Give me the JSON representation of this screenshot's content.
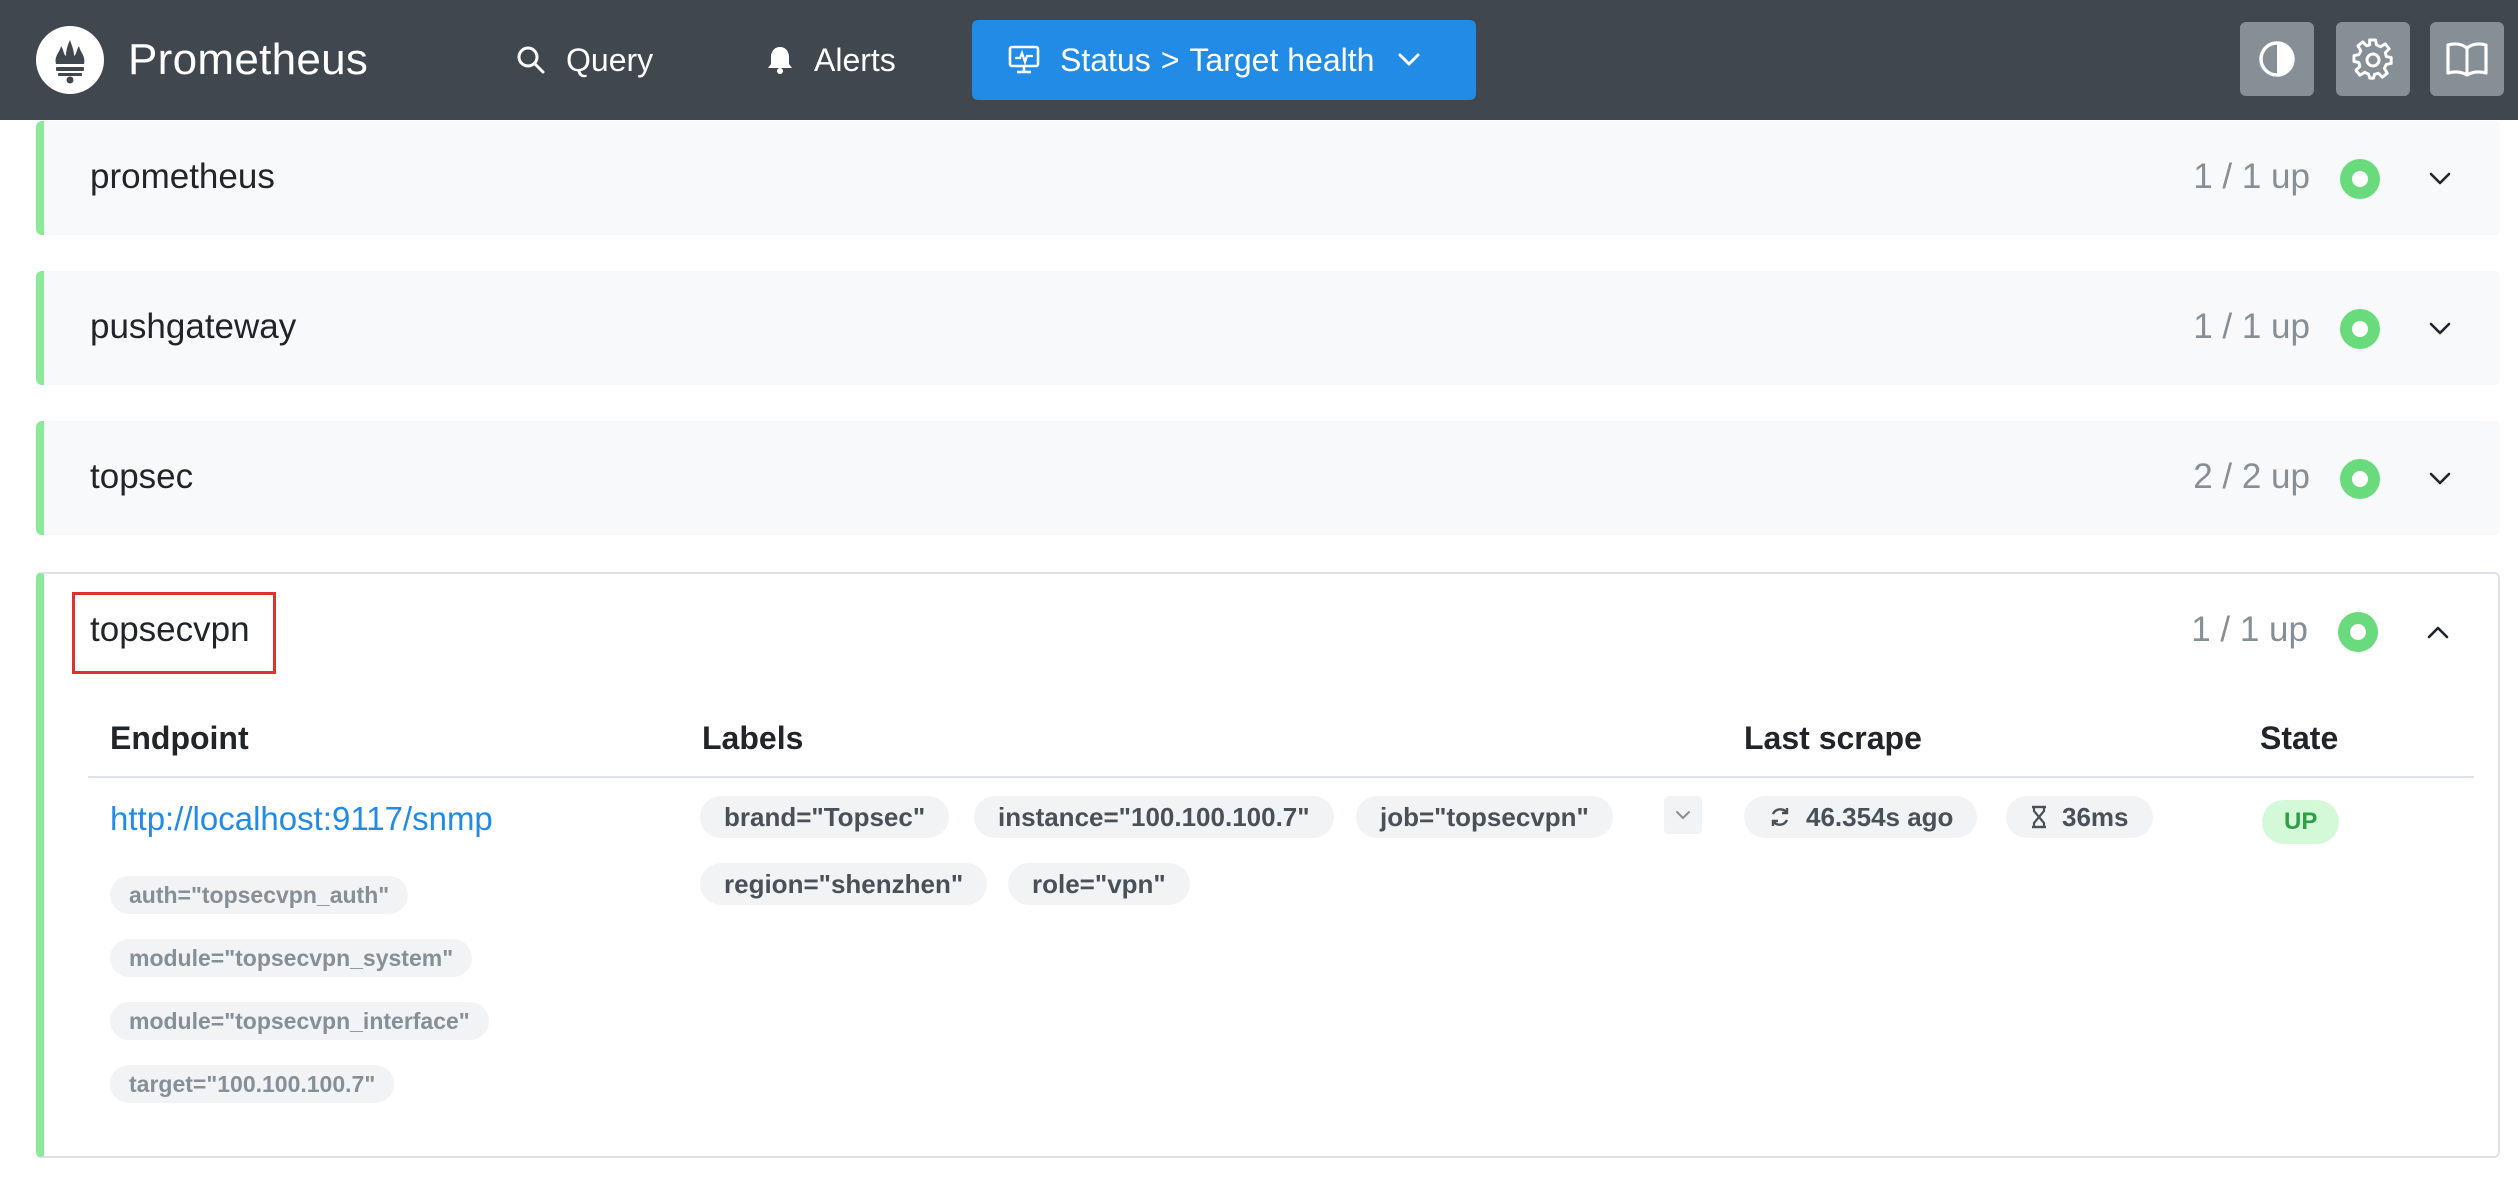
{
  "header": {
    "brand": "Prometheus",
    "nav": {
      "query": "Query",
      "alerts": "Alerts",
      "status_prefix": "Status",
      "status_sep": ">",
      "status_page": "Target health"
    }
  },
  "pools": [
    {
      "name": "prometheus",
      "count": "1 / 1 up"
    },
    {
      "name": "pushgateway",
      "count": "1 / 1 up"
    },
    {
      "name": "topsec",
      "count": "2 / 2 up"
    },
    {
      "name": "topsecvpn",
      "count": "1 / 1 up"
    }
  ],
  "colors": {
    "header_bg": "#41474f",
    "accent": "#228be6",
    "healthy": "#69db7c",
    "up_badge_bg": "#d3f9d8",
    "up_badge_text": "#2f9e44",
    "highlight": "#e03131"
  },
  "table": {
    "columns": [
      "Endpoint",
      "Labels",
      "Last scrape",
      "State"
    ],
    "row": {
      "endpoint": "http://localhost:9117/snmp",
      "params": [
        "auth=\"topsecvpn_auth\"",
        "module=\"topsecvpn_system\"",
        "module=\"topsecvpn_interface\"",
        "target=\"100.100.100.7\""
      ],
      "labels": [
        "brand=\"Topsec\"",
        "instance=\"100.100.100.7\"",
        "job=\"topsecvpn\"",
        "region=\"shenzhen\"",
        "role=\"vpn\""
      ],
      "last_scrape": "46.354s ago",
      "scrape_duration": "36ms",
      "state": "UP"
    }
  },
  "icons": {
    "query": "search-icon",
    "alerts": "bell-icon",
    "status": "monitor-icon",
    "theme": "contrast-icon",
    "settings": "gear-icon",
    "docs": "book-icon"
  }
}
